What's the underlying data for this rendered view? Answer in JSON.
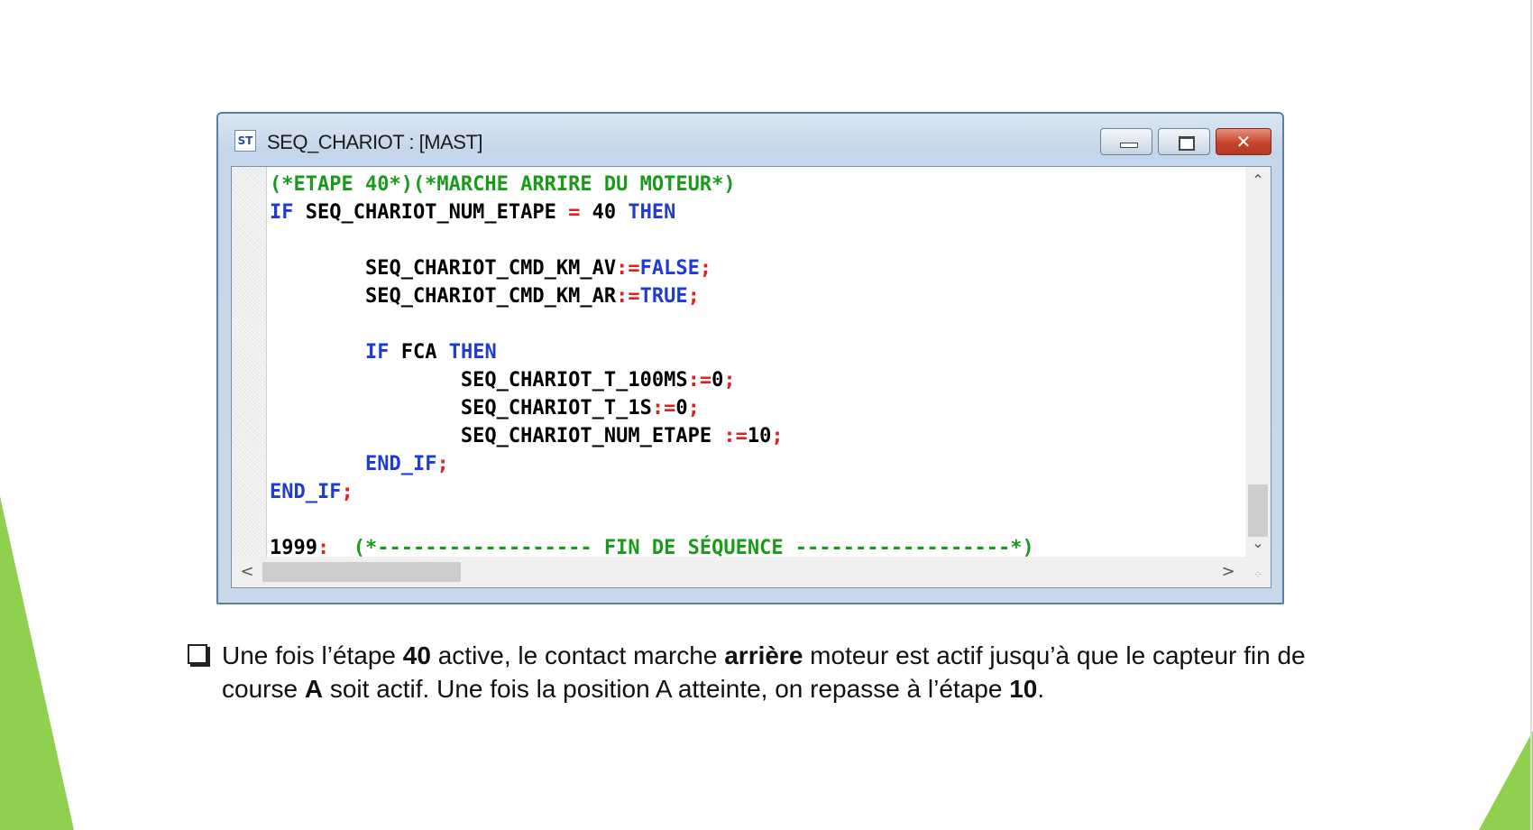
{
  "window": {
    "icon_text": "ST",
    "title": "SEQ_CHARIOT : [MAST]",
    "controls": {
      "minimize": "minimize",
      "maximize": "maximize",
      "close": "✕"
    }
  },
  "code": [
    [
      {
        "t": "(*ETAPE 40*)(*MARCHE ARRIRE DU MOTEUR*)",
        "c": "cm"
      }
    ],
    [
      {
        "t": "IF",
        "c": "kw"
      },
      {
        "t": " SEQ_CHARIOT_NUM_ETAPE ",
        "c": "id"
      },
      {
        "t": "=",
        "c": "op"
      },
      {
        "t": " 40 ",
        "c": "id"
      },
      {
        "t": "THEN",
        "c": "kw"
      }
    ],
    [],
    [
      {
        "t": "        SEQ_CHARIOT_CMD_KM_AV",
        "c": "id"
      },
      {
        "t": ":=",
        "c": "op"
      },
      {
        "t": "FALSE",
        "c": "kw"
      },
      {
        "t": ";",
        "c": "op"
      }
    ],
    [
      {
        "t": "        SEQ_CHARIOT_CMD_KM_AR",
        "c": "id"
      },
      {
        "t": ":=",
        "c": "op"
      },
      {
        "t": "TRUE",
        "c": "kw"
      },
      {
        "t": ";",
        "c": "op"
      }
    ],
    [],
    [
      {
        "t": "        ",
        "c": "id"
      },
      {
        "t": "IF",
        "c": "kw"
      },
      {
        "t": " FCA ",
        "c": "id"
      },
      {
        "t": "THEN",
        "c": "kw"
      }
    ],
    [
      {
        "t": "                SEQ_CHARIOT_T_100MS",
        "c": "id"
      },
      {
        "t": ":=",
        "c": "op"
      },
      {
        "t": "0",
        "c": "id"
      },
      {
        "t": ";",
        "c": "op"
      }
    ],
    [
      {
        "t": "                SEQ_CHARIOT_T_1S",
        "c": "id"
      },
      {
        "t": ":=",
        "c": "op"
      },
      {
        "t": "0",
        "c": "id"
      },
      {
        "t": ";",
        "c": "op"
      }
    ],
    [
      {
        "t": "                SEQ_CHARIOT_NUM_ETAPE ",
        "c": "id"
      },
      {
        "t": ":=",
        "c": "op"
      },
      {
        "t": "10",
        "c": "id"
      },
      {
        "t": ";",
        "c": "op"
      }
    ],
    [
      {
        "t": "        ",
        "c": "id"
      },
      {
        "t": "END_IF",
        "c": "kw"
      },
      {
        "t": ";",
        "c": "op"
      }
    ],
    [
      {
        "t": "END_IF",
        "c": "kw"
      },
      {
        "t": ";",
        "c": "op"
      }
    ],
    [],
    [
      {
        "t": "1999",
        "c": "id"
      },
      {
        "t": ":",
        "c": "op"
      },
      {
        "t": "  ",
        "c": "id"
      },
      {
        "t": "(*------------------ FIN DE SÉQUENCE ------------------*)",
        "c": "cm"
      }
    ]
  ],
  "scrollbars": {
    "up": "^",
    "down": "v",
    "left": "<",
    "right": ">"
  },
  "caption": {
    "parts": [
      {
        "t": "Une fois l’étape ",
        "b": false
      },
      {
        "t": "40",
        "b": true
      },
      {
        "t": " active, le contact marche ",
        "b": false
      },
      {
        "t": "arrière",
        "b": true
      },
      {
        "t": " moteur est actif jusqu’à que le capteur fin de course ",
        "b": false
      },
      {
        "t": "A",
        "b": true
      },
      {
        "t": " soit actif. Une fois la position  A atteinte, on repasse à l’étape ",
        "b": false
      },
      {
        "t": "10",
        "b": true
      },
      {
        "t": ".",
        "b": false
      }
    ]
  },
  "colors": {
    "keyword": "#1f3bd6",
    "comment": "#1a9a1a",
    "operator": "#e02020",
    "accent_green": "#8fd14f"
  }
}
